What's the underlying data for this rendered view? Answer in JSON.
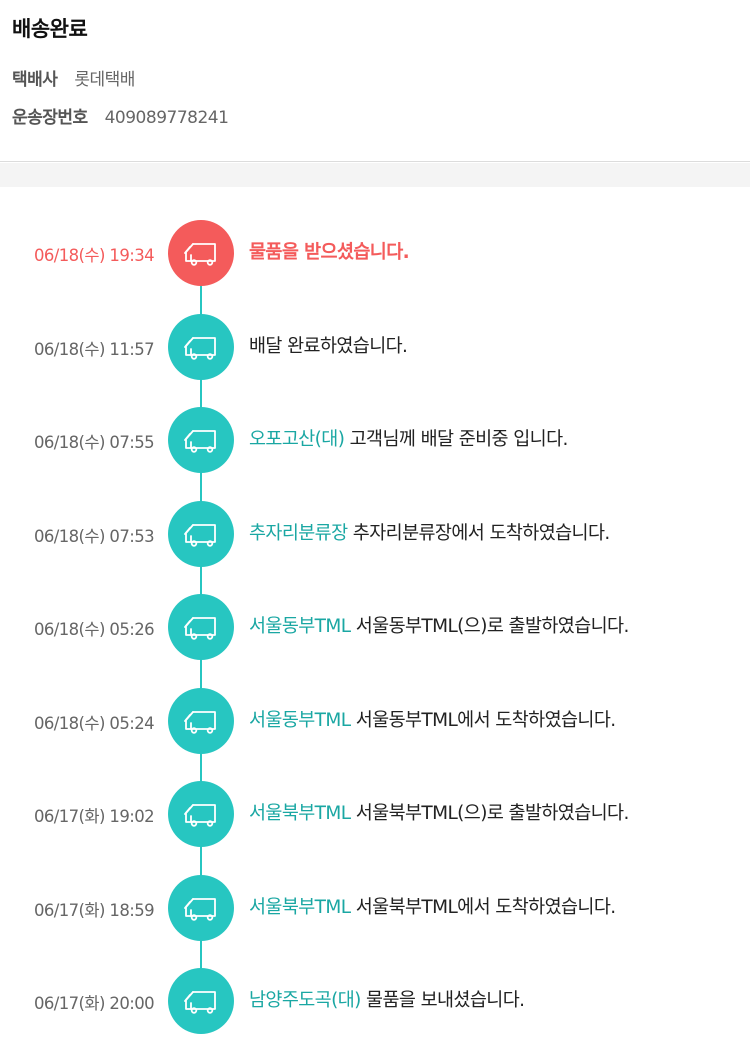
{
  "status": {
    "title": "배송완료"
  },
  "carrier": {
    "label": "택배사",
    "value": "롯데택배"
  },
  "tracking": {
    "label": "운송장번호",
    "value": "409089778241"
  },
  "colors": {
    "accent": "#27c6c1",
    "active": "#f45b5b",
    "location_text": "#1aa7a3"
  },
  "icon": "delivery-truck-icon",
  "events": [
    {
      "time": "06/18(수) 19:34",
      "location": "",
      "message": "물품을 받으셨습니다.",
      "active": true
    },
    {
      "time": "06/18(수) 11:57",
      "location": "",
      "message": "배달 완료하였습니다.",
      "active": false
    },
    {
      "time": "06/18(수) 07:55",
      "location": "오포고산(대)",
      "message": " 고객님께 배달 준비중 입니다.",
      "active": false
    },
    {
      "time": "06/18(수) 07:53",
      "location": "추자리분류장",
      "message": " 추자리분류장에서 도착하였습니다.",
      "active": false
    },
    {
      "time": "06/18(수) 05:26",
      "location": "서울동부TML",
      "message": " 서울동부TML(으)로 출발하였습니다.",
      "active": false
    },
    {
      "time": "06/18(수) 05:24",
      "location": "서울동부TML",
      "message": " 서울동부TML에서 도착하였습니다.",
      "active": false
    },
    {
      "time": "06/17(화) 19:02",
      "location": "서울북부TML",
      "message": " 서울북부TML(으)로 출발하였습니다.",
      "active": false
    },
    {
      "time": "06/17(화) 18:59",
      "location": "서울북부TML",
      "message": " 서울북부TML에서 도착하였습니다.",
      "active": false
    },
    {
      "time": "06/17(화) 20:00",
      "location": "남양주도곡(대)",
      "message": " 물품을 보내셨습니다.",
      "active": false
    }
  ]
}
